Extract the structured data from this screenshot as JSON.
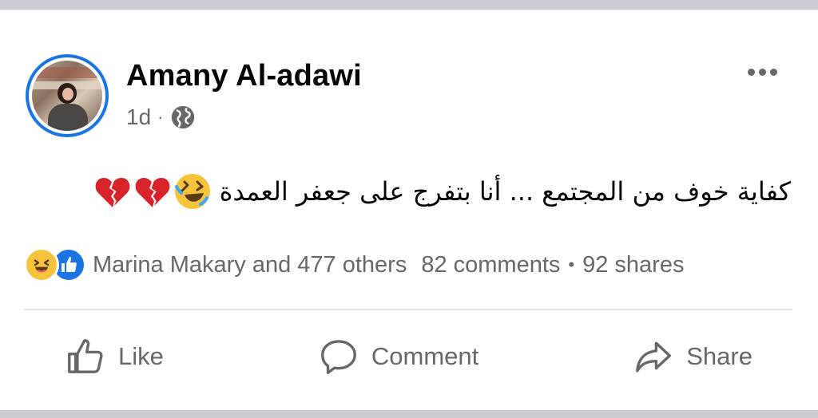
{
  "post": {
    "author": "Amany Al-adawi",
    "time": "1d",
    "separator": "·",
    "audience_icon": "globe-icon",
    "body": "كفاية خوف من المجتمع ... أنا بتفرج على جعفر العمدة",
    "emojis": [
      "rolling-on-floor-laughing-emoji",
      "broken-heart-emoji",
      "broken-heart-emoji"
    ]
  },
  "reactions": {
    "icons": [
      "haha-reaction-icon",
      "like-reaction-icon"
    ],
    "summary": "Marina Makary and 477 others",
    "comments": "82 comments",
    "dot": "•",
    "shares": "92 shares"
  },
  "actions": {
    "like": "Like",
    "comment": "Comment",
    "share": "Share"
  },
  "colors": {
    "accent": "#1b74e4",
    "secondary_text": "#65676b",
    "divider": "#e4e6eb",
    "frame": "#c9ccd1"
  }
}
